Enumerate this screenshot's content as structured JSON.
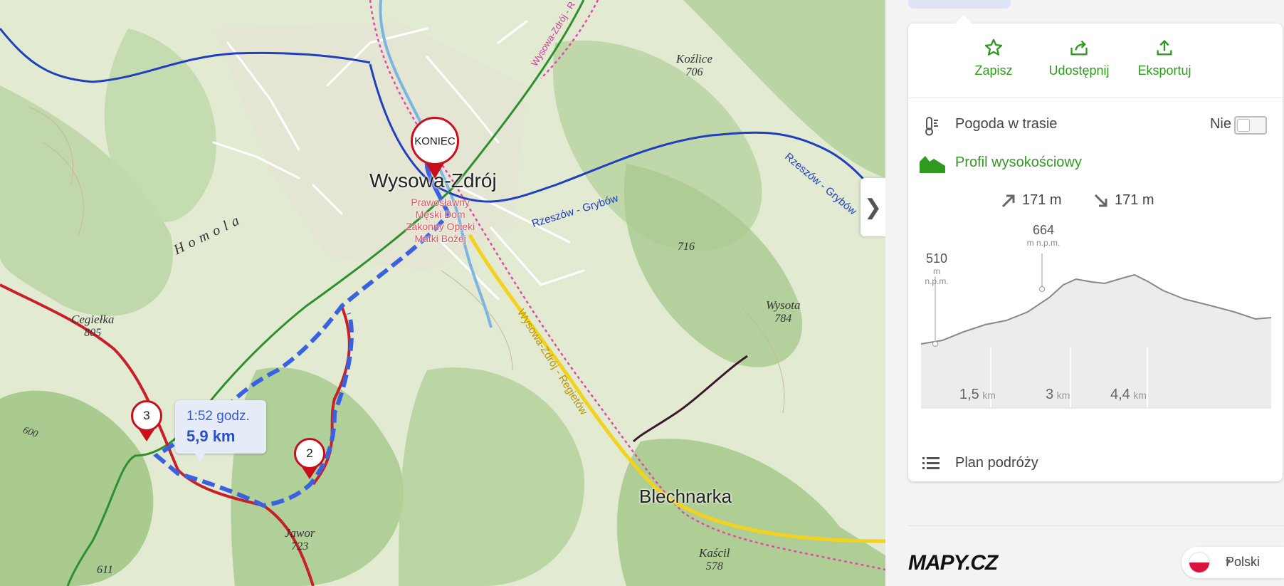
{
  "map": {
    "town_main": "Wysowa-Zdrój",
    "town_second": "Blechnarka",
    "poi_lines": [
      "Prawosławny",
      "Męski Dom",
      "Zakonny Opieki",
      "Matki Bożej"
    ],
    "road_labels": {
      "rzeszow_grybow_1": "Rzeszów - Grybów",
      "rzeszow_grybow_2": "Rzeszów - Grybów",
      "wysowa_regietow": "Wysowa-Zdrój - Regietów",
      "wysowa_top": "Wysowa-Zdrój - R"
    },
    "ridge": "Homola",
    "peaks": [
      {
        "name": "Koźlice",
        "elev": "706"
      },
      {
        "name": "",
        "elev": "716"
      },
      {
        "name": "Wysota",
        "elev": "784"
      },
      {
        "name": "Cegiełka",
        "elev": "805"
      },
      {
        "name": "Jawor",
        "elev": "723"
      },
      {
        "name": "Kaścil",
        "elev": "578"
      },
      {
        "name": "",
        "elev": "611"
      },
      {
        "name": "",
        "elev": "600"
      }
    ],
    "markers": {
      "end": "KONIEC",
      "wp2": "2",
      "wp3": "3"
    },
    "route_bubble": {
      "time": "1:52 godz.",
      "distance": "5,9 km"
    },
    "collapse_icon": "chevron-right-icon"
  },
  "panel": {
    "actions": [
      {
        "label": "Zapisz",
        "icon": "star-icon"
      },
      {
        "label": "Udostępnij",
        "icon": "share-icon"
      },
      {
        "label": "Eksportuj",
        "icon": "upload-icon"
      }
    ],
    "weather": {
      "label": "Pogoda w trasie",
      "toggle_text": "Nie",
      "enabled": false
    },
    "profile": {
      "label": "Profil wysokościowy",
      "color": "#2f9a1e"
    },
    "ascent": "171 m",
    "descent": "171 m",
    "elevation": {
      "start_value": "510",
      "max_value": "664",
      "unit_label": "m n.p.m.",
      "ticks": [
        {
          "value": "1,5",
          "unit": "km"
        },
        {
          "value": "3",
          "unit": "km"
        },
        {
          "value": "4,4",
          "unit": "km"
        }
      ]
    },
    "itinerary": "Plan podróży",
    "logo": "MAPY.CZ",
    "language": "Polski"
  },
  "colors": {
    "accent": "#2f9a1e",
    "route": "#3a62e0",
    "marker": "#c8101c"
  }
}
